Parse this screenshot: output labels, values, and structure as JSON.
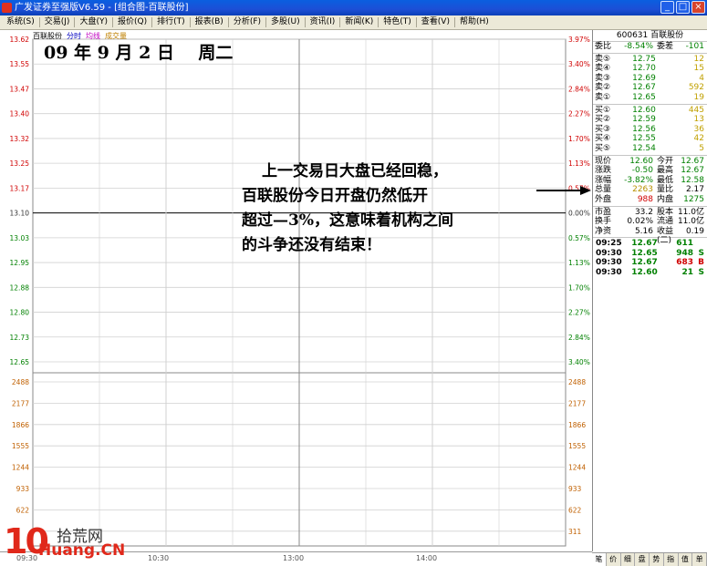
{
  "window": {
    "title": "广发证券至强版V6.59 - [组合图-百联股份]"
  },
  "menu": [
    "系统(S)",
    "交易(J)",
    "大盘(Y)",
    "报价(Q)",
    "排行(T)",
    "报表(B)",
    "分析(F)",
    "多股(U)",
    "资讯(I)",
    "新闻(K)",
    "特色(T)",
    "查看(V)",
    "帮助(H)"
  ],
  "chart": {
    "stock_name": "百联股份",
    "tab_fenshi": "分时",
    "tab_junxian": "均线",
    "tab_volume": "成交量",
    "colors": {
      "price_up": "#d00000",
      "price_down": "#008000",
      "grid": "#c8c8c8",
      "mid": "#000000"
    }
  },
  "chart_data": {
    "type": "line",
    "price_axis_left": [
      "13.62",
      "13.55",
      "13.47",
      "13.40",
      "13.32",
      "13.25",
      "13.17",
      "13.10",
      "13.03",
      "12.95",
      "12.88",
      "12.80",
      "12.73",
      "12.65"
    ],
    "price_axis_right": [
      "3.97%",
      "3.40%",
      "2.84%",
      "2.27%",
      "1.70%",
      "1.13%",
      "0.57%",
      "0.00%",
      "0.57%",
      "1.13%",
      "1.70%",
      "2.27%",
      "2.84%",
      "3.40%"
    ],
    "volume_axis_left": [
      "2488",
      "2177",
      "1866",
      "1555",
      "1244",
      "933",
      "622"
    ],
    "volume_axis_right": [
      "2488",
      "2177",
      "1866",
      "1555",
      "1244",
      "933",
      "622",
      "311"
    ],
    "time_labels": [
      "09:30",
      "10:30",
      "13:00",
      "14:00"
    ],
    "series": []
  },
  "annotation": {
    "date": "09 年 9 月 2 日    周二",
    "lines": [
      "上一交易日大盘已经回稳，",
      "百联股份今日开盘仍然低开",
      "超过—3%，这意味着机构之间",
      "的斗争还没有结束！"
    ]
  },
  "side": {
    "title": "600631 百联股份",
    "weibi": {
      "label": "委比",
      "value": "-8.54%",
      "label2": "委差",
      "value2": "-101"
    },
    "asks": [
      {
        "label": "卖⑤",
        "price": "12.75",
        "vol": "12"
      },
      {
        "label": "卖④",
        "price": "12.70",
        "vol": "15"
      },
      {
        "label": "卖③",
        "price": "12.69",
        "vol": "4"
      },
      {
        "label": "卖②",
        "price": "12.67",
        "vol": "592"
      },
      {
        "label": "卖①",
        "price": "12.65",
        "vol": "19"
      }
    ],
    "bids": [
      {
        "label": "买①",
        "price": "12.60",
        "vol": "445"
      },
      {
        "label": "买②",
        "price": "12.59",
        "vol": "13"
      },
      {
        "label": "买③",
        "price": "12.56",
        "vol": "36"
      },
      {
        "label": "买④",
        "price": "12.55",
        "vol": "42"
      },
      {
        "label": "买⑤",
        "price": "12.54",
        "vol": "5"
      }
    ],
    "stats": [
      {
        "l1": "现价",
        "v1": "12.60",
        "l2": "今开",
        "v2": "12.67"
      },
      {
        "l1": "涨跌",
        "v1": "-0.50",
        "l2": "最高",
        "v2": "12.67"
      },
      {
        "l1": "涨幅",
        "v1": "-3.82%",
        "l2": "最低",
        "v2": "12.58"
      },
      {
        "l1": "总量",
        "v1": "2263",
        "l2": "量比",
        "v2": "2.17"
      },
      {
        "l1": "外盘",
        "v1": "988",
        "l2": "内盘",
        "v2": "1275"
      }
    ],
    "stats2": [
      {
        "l1": "市盈",
        "v1": "33.2",
        "l2": "股本",
        "v2": "11.0亿"
      },
      {
        "l1": "换手",
        "v1": "0.02%",
        "l2": "流通",
        "v2": "11.0亿"
      },
      {
        "l1": "净资",
        "v1": "5.16",
        "l2": "收益(二)",
        "v2": "0.19"
      }
    ],
    "trades": [
      {
        "time": "09:25",
        "price": "12.67",
        "vol": "611",
        "dir": ""
      },
      {
        "time": "09:30",
        "price": "12.65",
        "vol": "948",
        "dir": "S"
      },
      {
        "time": "09:30",
        "price": "12.67",
        "vol": "683",
        "dir": "B"
      },
      {
        "time": "09:30",
        "price": "12.60",
        "vol": "21",
        "dir": "S"
      }
    ],
    "tabs": [
      "笔",
      "价",
      "细",
      "盘",
      "势",
      "指",
      "值",
      "单"
    ]
  },
  "watermark": {
    "logo_num": "10",
    "cn": "拾荒网",
    "url": "Huang.CN"
  }
}
